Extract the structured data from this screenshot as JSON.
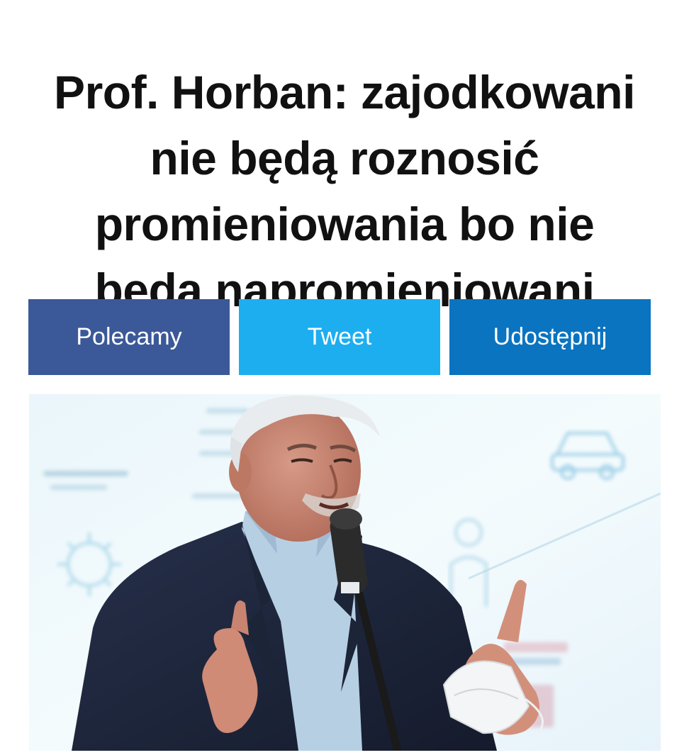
{
  "article": {
    "headline_lines": [
      "Prof. Horban: zajodkowani",
      "nie będą roznosić",
      "promieniowania bo nie",
      "będą napromieniowani"
    ]
  },
  "share": {
    "facebook_label": "Polecamy",
    "twitter_label": "Tweet",
    "share_label": "Udostępnij"
  },
  "colors": {
    "facebook": "#3b5998",
    "twitter": "#1daef0",
    "share": "#0a74c0"
  },
  "icons": {
    "background": [
      "virus-icon",
      "car-icon",
      "person-icon"
    ]
  }
}
